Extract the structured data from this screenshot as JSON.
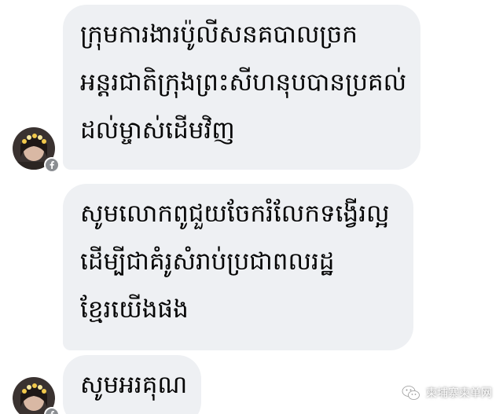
{
  "messages": [
    {
      "lines": [
        "ក្រុមការងារប៉ូលីសនគបាលច្រក",
        "អន្តរជាតិក្រុងព្រះសីហនុបបានប្រគល់",
        "ដល់ម្ចាស់ដើមវិញ"
      ]
    },
    {
      "lines": [
        "សូមលោកពូជួយចែករំលែកទង្វើរល្អ",
        "ដើម្បីជាគំរូសំរាប់ប្រជាពលរដ្ឋ",
        "ខ្មែរយើងផង"
      ]
    },
    {
      "lines": [
        "សូមអរគុណ"
      ]
    }
  ],
  "watermark": {
    "text": "柬埔寨柬单网",
    "icon": "wechat-icon"
  },
  "icons": {
    "avatar_badge": "facebook-icon"
  },
  "colors": {
    "bubble_bg": "#eef0f3",
    "text": "#050505",
    "badge": "#8a8d91"
  }
}
